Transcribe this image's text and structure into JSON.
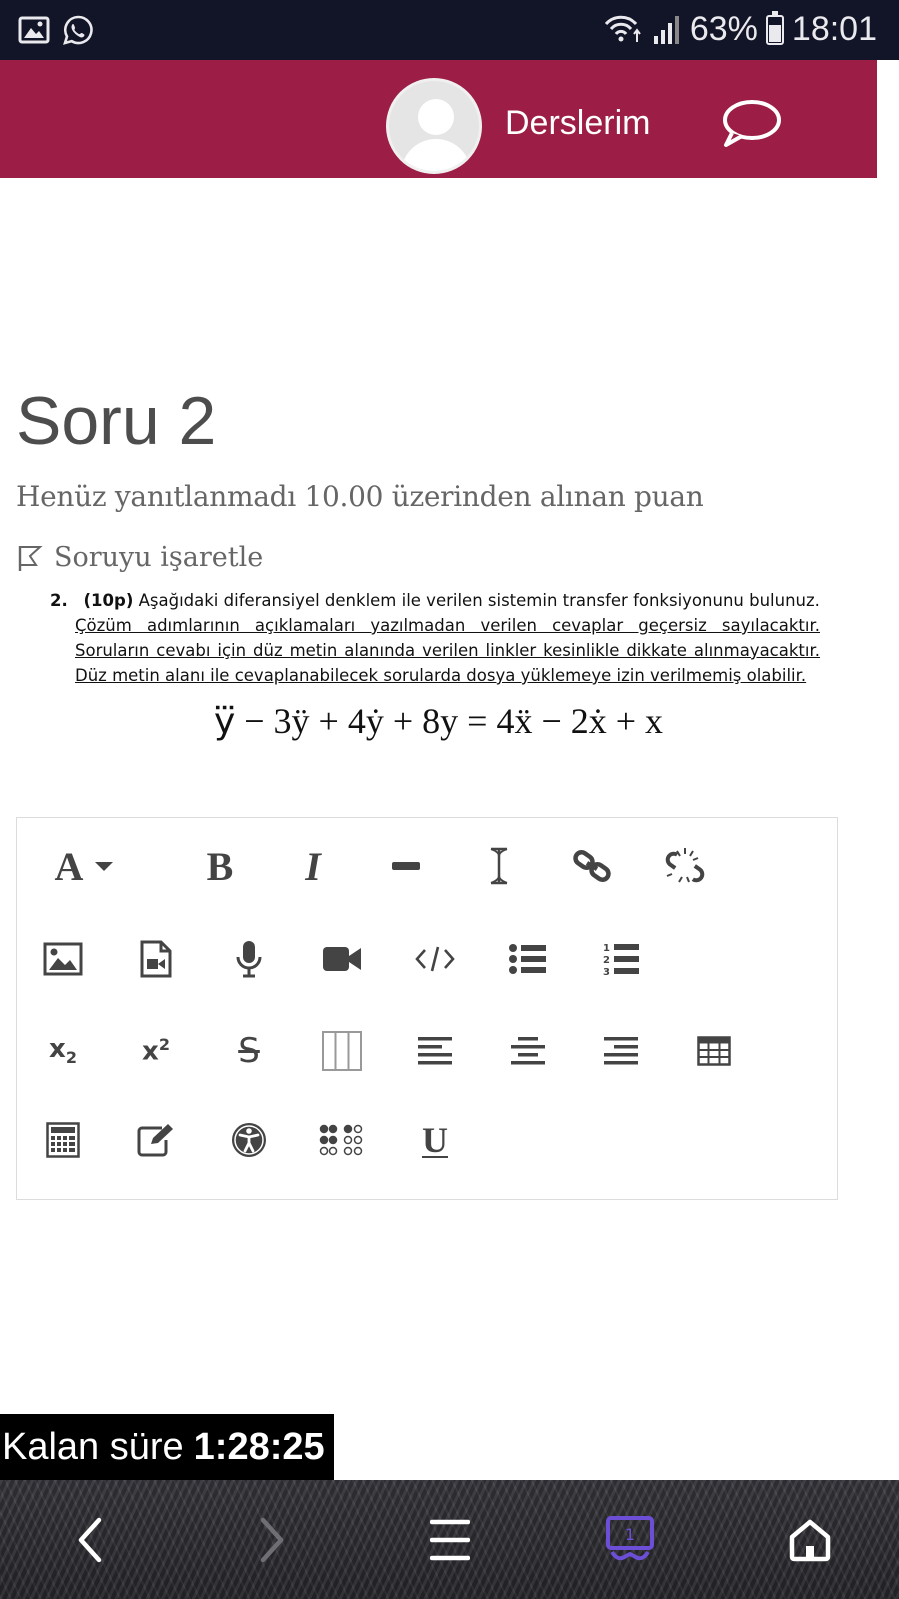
{
  "status_bar": {
    "battery": "63%",
    "battery_level": 0.63,
    "time": "18:01",
    "left_icons": [
      "gallery-icon",
      "whatsapp-icon"
    ],
    "right_icons": [
      "wifi-icon",
      "signal-icon",
      "battery-icon"
    ]
  },
  "header": {
    "background": "#9c1d45",
    "title": "Derslerim",
    "icons": [
      "avatar",
      "message-icon"
    ]
  },
  "question": {
    "title": "Soru 2",
    "status": "Henüz yanıtlanmadı  10.00 üzerinden alınan puan",
    "flag_label": "Soruyu işaretle",
    "number": "2.",
    "points": "(10p)",
    "text": "Aşağıdaki diferansiyel denklem ile verilen sistemin transfer fonksiyonunu bulunuz.",
    "notes": [
      "Çözüm adımlarının açıklamaları yazılmadan verilen cevaplar geçersiz sayılacaktır.",
      "Soruların cevabı için düz metin alanında verilen linkler kesinlikle dikkate alınmayacaktır.",
      "Düz metin alanı ile cevaplanabilecek sorularda dosya yüklemeye izin verilmemiş olabilir."
    ],
    "equation": "y⃛ − 3ÿ + 4ẏ + 8y = 4ẍ − 2ẋ + x"
  },
  "editor_toolbar": {
    "rows": [
      [
        "font-color-icon",
        "bold-icon",
        "italic-icon",
        "horizontal-rule-icon",
        "clear-format-icon",
        "link-icon",
        "unlink-icon"
      ],
      [
        "image-icon",
        "media-file-icon",
        "record-audio-icon",
        "record-video-icon",
        "html-code-icon",
        "bullet-list-icon",
        "numbered-list-icon"
      ],
      [
        "subscript-icon",
        "superscript-icon",
        "strikethrough-icon",
        "table-columns-icon",
        "align-left-icon",
        "align-center-icon",
        "align-right-icon",
        "table-icon"
      ],
      [
        "calculator-icon",
        "edit-icon",
        "accessibility-icon",
        "braille-icon",
        "underline-icon"
      ]
    ],
    "font_glyph": "A",
    "bold_glyph": "B",
    "italic_glyph": "I",
    "underline_glyph": "U",
    "subscript_glyph": "x",
    "subscript_digit": "2",
    "superscript_glyph": "x",
    "superscript_digit": "2",
    "strike_glyph": "S"
  },
  "timer": {
    "label": "Kalan süre",
    "value": "1:28:25"
  },
  "nav_bar": {
    "buttons": [
      "back-icon",
      "forward-icon",
      "menu-icon",
      "tabs-icon",
      "home-icon"
    ],
    "tab_count": "1",
    "accent": "#6c4fd6"
  }
}
